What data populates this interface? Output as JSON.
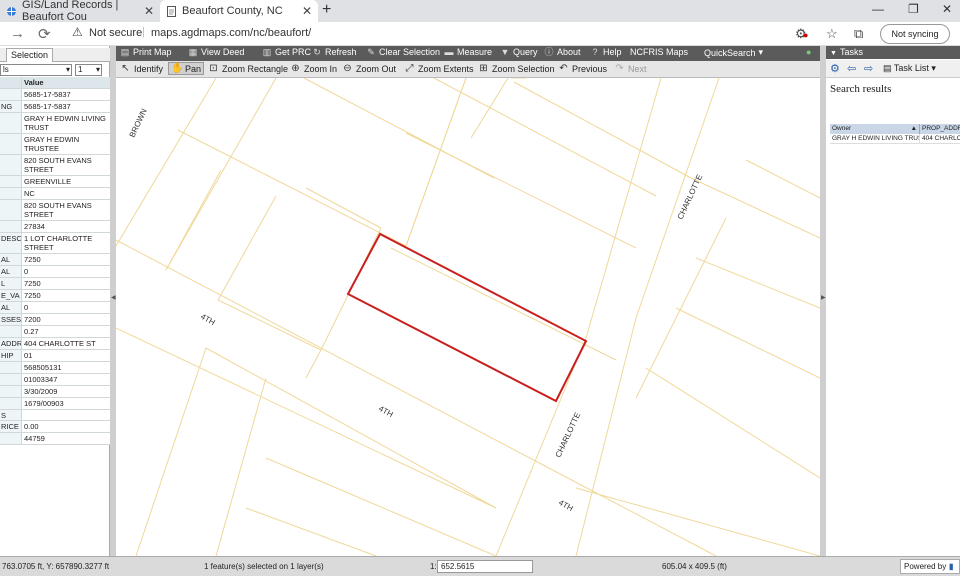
{
  "browser": {
    "tabs": [
      {
        "title": "GIS/Land Records | Beaufort Cou",
        "active": false
      },
      {
        "title": "Beaufort County, NC",
        "active": true
      }
    ],
    "security": "Not secure",
    "url": "maps.agdmaps.com/nc/beaufort/",
    "sync": "Not syncing"
  },
  "left_panel": {
    "tab": "Selection",
    "select1": "ls",
    "select2": "1",
    "header": {
      "key": "",
      "value": "Value"
    },
    "rows": [
      {
        "k": "",
        "v": "5685-17-5837"
      },
      {
        "k": "NG",
        "v": "5685-17-5837"
      },
      {
        "k": "",
        "v": "GRAY H EDWIN LIVING TRUST"
      },
      {
        "k": "",
        "v": "GRAY H EDWIN TRUSTEE"
      },
      {
        "k": "",
        "v": "820 SOUTH EVANS STREET"
      },
      {
        "k": "",
        "v": "GREENVILLE"
      },
      {
        "k": "",
        "v": "NC"
      },
      {
        "k": "",
        "v": "820 SOUTH EVANS STREET"
      },
      {
        "k": "",
        "v": "27834"
      },
      {
        "k": "DESC",
        "v": "1 LOT CHARLOTTE STREET"
      },
      {
        "k": "AL",
        "v": "7250"
      },
      {
        "k": "AL",
        "v": "0"
      },
      {
        "k": "L",
        "v": "7250"
      },
      {
        "k": "E_VA",
        "v": "7250"
      },
      {
        "k": "AL",
        "v": "0"
      },
      {
        "k": "SSES",
        "v": "7200"
      },
      {
        "k": "",
        "v": "0.27"
      },
      {
        "k": "ADDR",
        "v": "404 CHARLOTTE ST"
      },
      {
        "k": "HIP",
        "v": "01"
      },
      {
        "k": "",
        "v": "568505131"
      },
      {
        "k": "",
        "v": "01003347"
      },
      {
        "k": "",
        "v": "3/30/2009"
      },
      {
        "k": "",
        "v": "1679/00903"
      },
      {
        "k": "S",
        "v": ""
      },
      {
        "k": "RICE",
        "v": "0.00"
      },
      {
        "k": "",
        "v": "44759"
      }
    ]
  },
  "toolbar1": {
    "print_map": "Print Map",
    "view_deed": "View Deed",
    "get_prc": "Get PRC",
    "refresh": "Refresh",
    "clear_selection": "Clear Selection",
    "measure": "Measure",
    "query": "Query",
    "about": "About",
    "help": "Help",
    "ncfris": "NCFRIS Maps",
    "quicksearch": "QuickSearch"
  },
  "toolbar2": {
    "identify": "Identify",
    "pan": "Pan",
    "zoom_rectangle": "Zoom Rectangle",
    "zoom_in": "Zoom In",
    "zoom_out": "Zoom Out",
    "zoom_extents": "Zoom Extents",
    "zoom_selection": "Zoom Selection",
    "previous": "Previous",
    "next": "Next"
  },
  "map": {
    "labels": {
      "brown": "BROWN",
      "charlotte_top": "CHARLOTTE",
      "fourth_left": "4TH",
      "fourth_mid": "4TH",
      "charlotte_bottom": "CHARLOTTE",
      "fourth_bottom": "4TH"
    },
    "parcel_color": "#f0d89a",
    "selection_color": "#c8201e"
  },
  "right_panel": {
    "header": "Tasks",
    "task_list": "Task List",
    "title": "Search results",
    "columns": [
      "Owner",
      "PROP_ADDR"
    ],
    "rows": [
      [
        "GRAY H EDWIN LIVING TRUST",
        "404 CHARLO"
      ]
    ]
  },
  "status": {
    "coords": "763.0705 ft, Y: 657890.3277 ft",
    "selected": "1 feature(s) selected on 1 layer(s)",
    "scale_prefix": "1:",
    "scale": "652.5615",
    "extent": "605.04 x 409.5 (ft)",
    "powered_by": "Powered by"
  }
}
